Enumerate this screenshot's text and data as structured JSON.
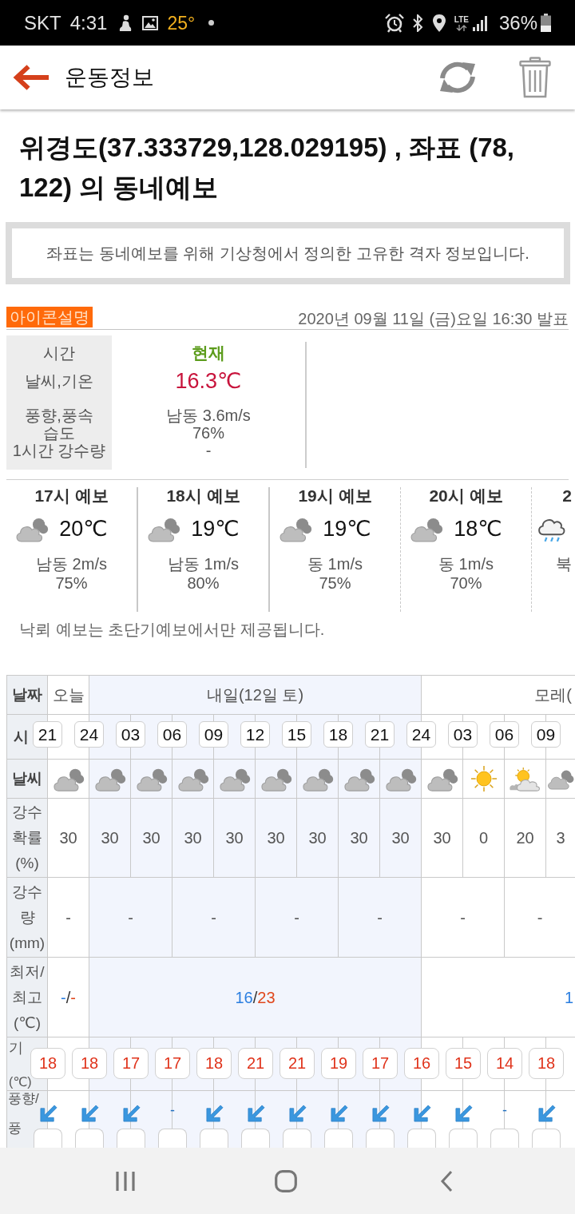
{
  "status_bar": {
    "carrier": "SKT",
    "time": "4:31",
    "temperature": "25°",
    "network": "LTE",
    "battery": "36%"
  },
  "app_bar": {
    "title": "운동정보"
  },
  "heading": "위경도(37.333729,128.029195) , 좌표 (78, 122) 의 동네예보",
  "notice": "좌표는 동네예보를 위해 기상청에서 정의한 고유한 격자 정보입니다.",
  "legend_button": "아이콘설명",
  "issued": "2020년 09월 11일 (금)요일 16:30 발표",
  "current": {
    "rows": [
      {
        "label": "시간",
        "kind": "time",
        "value": "현재"
      },
      {
        "label": "날씨,기온",
        "kind": "temperature",
        "value": "16.3℃"
      },
      {
        "label": "풍향,풍속",
        "kind": "text",
        "value": "남동 3.6m/s"
      },
      {
        "label": "습도",
        "kind": "text",
        "value": "76%"
      },
      {
        "label": "1시간 강수량",
        "kind": "text",
        "value": "-"
      }
    ]
  },
  "hourly": [
    {
      "time": "17시 예보",
      "kind": "cloudy",
      "temperature": "20℃",
      "wind": "남동 2m/s",
      "humidity": "75%",
      "dashed_divider": false
    },
    {
      "time": "18시 예보",
      "kind": "cloudy",
      "temperature": "19℃",
      "wind": "남동 1m/s",
      "humidity": "80%",
      "dashed_divider": false
    },
    {
      "time": "19시 예보",
      "kind": "cloudy",
      "temperature": "19℃",
      "wind": "동 1m/s",
      "humidity": "75%",
      "dashed_divider": true
    },
    {
      "time": "20시 예보",
      "kind": "cloudy",
      "temperature": "18℃",
      "wind": "동 1m/s",
      "humidity": "70%",
      "dashed_divider": true
    },
    {
      "time": "2",
      "kind": "rain",
      "wind": "북"
    }
  ],
  "lightning_note": "낙뢰 예보는 초단기예보에서만 제공됩니다.",
  "table": {
    "labels": {
      "date": "날짜",
      "time": "시",
      "sky": "날씨",
      "rain_chance": "강수\n확률\n(%)",
      "rainfall": "강수\n량\n(mm)",
      "low_high": "최저/\n최고\n(℃)",
      "temperature": [
        "기",
        "(℃)"
      ],
      "wind": [
        "풍향/",
        "풍"
      ]
    },
    "days": [
      {
        "label": "오늘",
        "shaded": false,
        "rainfall": [
          "-"
        ],
        "low": "-",
        "sep": "/",
        "high": "-",
        "slots": [
          {
            "time": "21",
            "kind": "cloudy",
            "rain_chance": "30",
            "temperature": "18",
            "wind": {
              "kind": "arrow"
            }
          }
        ]
      },
      {
        "label": "내일(12일 토)",
        "shaded": true,
        "rainfall": [
          "-",
          "-",
          "-",
          "-"
        ],
        "low": "16",
        "sep": "/",
        "high": "23",
        "slots": [
          {
            "time": "24",
            "kind": "cloudy",
            "rain_chance": "30",
            "temperature": "18",
            "wind": {
              "kind": "arrow"
            }
          },
          {
            "time": "03",
            "kind": "cloudy",
            "rain_chance": "30",
            "temperature": "17",
            "wind": {
              "kind": "arrow"
            }
          },
          {
            "time": "06",
            "kind": "cloudy",
            "rain_chance": "30",
            "temperature": "17",
            "wind": {
              "kind": "calm",
              "text": "-"
            }
          },
          {
            "time": "09",
            "kind": "cloudy",
            "rain_chance": "30",
            "temperature": "18",
            "wind": {
              "kind": "arrow"
            }
          },
          {
            "time": "12",
            "kind": "cloudy",
            "rain_chance": "30",
            "temperature": "21",
            "wind": {
              "kind": "arrow"
            }
          },
          {
            "time": "15",
            "kind": "cloudy",
            "rain_chance": "30",
            "temperature": "21",
            "wind": {
              "kind": "arrow"
            }
          },
          {
            "time": "18",
            "kind": "cloudy",
            "rain_chance": "30",
            "temperature": "19",
            "wind": {
              "kind": "arrow"
            }
          },
          {
            "time": "21",
            "kind": "cloudy",
            "rain_chance": "30",
            "temperature": "17",
            "wind": {
              "kind": "arrow"
            }
          }
        ]
      },
      {
        "label": "모레(",
        "shaded": false,
        "rainfall": [
          "-",
          "-"
        ],
        "low": "1",
        "slots": [
          {
            "time": "24",
            "kind": "cloudy",
            "rain_chance": "30",
            "temperature": "16",
            "wind": {
              "kind": "arrow"
            }
          },
          {
            "time": "03",
            "kind": "sunny",
            "rain_chance": "0",
            "temperature": "15",
            "wind": {
              "kind": "arrow"
            }
          },
          {
            "time": "06",
            "kind": "partlycloudy",
            "rain_chance": "20",
            "temperature": "14",
            "wind": {
              "kind": "calm",
              "text": "-"
            }
          },
          {
            "time": "09",
            "kind": "cloudy",
            "rain_chance": "3",
            "temperature": "18",
            "wind": {
              "kind": "arrow"
            }
          }
        ]
      }
    ]
  }
}
